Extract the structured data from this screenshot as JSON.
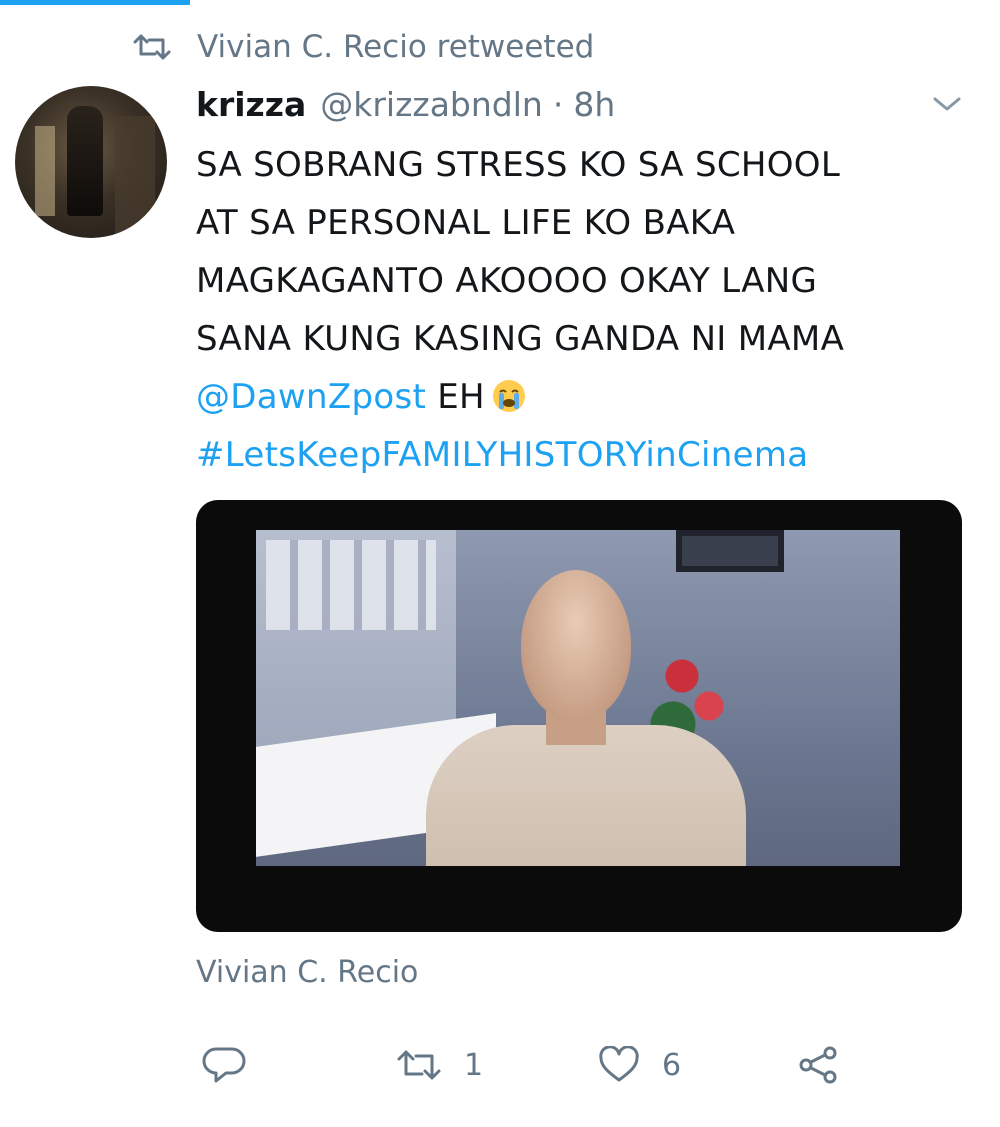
{
  "retweet_context": {
    "text": "Vivian C. Recio retweeted",
    "icon": "retweet-icon"
  },
  "tweet": {
    "display_name": "krizza",
    "handle": "@krizzabndln",
    "separator": "·",
    "time": "8h",
    "text_lines": [
      "SA SOBRANG STRESS KO SA SCHOOL",
      "AT SA PERSONAL LIFE KO BAKA",
      "MAGKAGANTO AKOOOO OKAY LANG",
      "SANA KUNG KASING GANDA NI MAMA"
    ],
    "mention": "@DawnZpost",
    "after_mention": "EH",
    "emoji": "crying-face-emoji",
    "hashtag": "#LetsKeepFAMILYHISTORYinCinema",
    "social_context": "Vivian C. Recio"
  },
  "actions": {
    "reply": {
      "icon": "reply-icon",
      "count": ""
    },
    "retweet": {
      "icon": "retweet-icon",
      "count": "1"
    },
    "like": {
      "icon": "heart-icon",
      "count": "6"
    },
    "share": {
      "icon": "share-icon"
    }
  },
  "colors": {
    "accent": "#1da1f2",
    "text": "#14171a",
    "secondary": "#657786"
  }
}
